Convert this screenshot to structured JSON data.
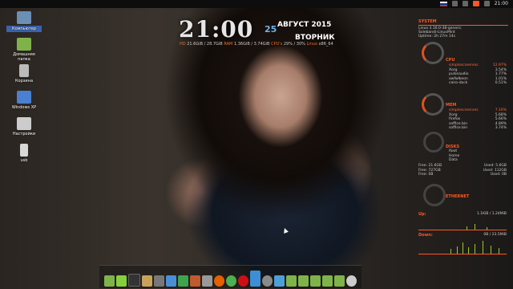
{
  "topbar": {
    "time": "21:00",
    "icons": [
      "flag-icon",
      "network-icon",
      "battery-icon",
      "app-icon",
      "power-icon"
    ]
  },
  "desktop_icons": [
    {
      "label": "Компьютер",
      "icon": "computer-icon",
      "color": "#6b8fb5",
      "selected": true
    },
    {
      "label": "Домашняя папка",
      "icon": "home-folder-icon",
      "color": "#7fb34a"
    },
    {
      "label": "Корзина",
      "icon": "trash-icon",
      "color": "#bbbbbb"
    },
    {
      "label": "Windows XP",
      "icon": "windows-xp-icon",
      "color": "#4a7fd1"
    },
    {
      "label": "Настройки",
      "icon": "settings-icon",
      "color": "#cccccc"
    },
    {
      "label": "usb",
      "icon": "usb-drive-icon",
      "color": "#d8d8d8"
    }
  ],
  "clock": {
    "time": "21:00",
    "day": "25",
    "month": "АВГУСТ 2015",
    "weekday": "ВТОРНИК"
  },
  "sysinfo": {
    "hd_label": "HD",
    "hd_value": "21.6GiB / 28.7GiB",
    "ram_label": "RAM",
    "ram_value": "1.36GiB / 3.74GiB",
    "cpu_label": "CPU's",
    "cpu_value": "29% / 30%",
    "os_label": "Linux",
    "os_value": "x86_64"
  },
  "conky": {
    "system_title": "SYSTEM",
    "kernel": "Linux 3.16.0-38-generic",
    "host": "Solebandi-LinuxMint",
    "uptime": "Uptime: 2h 27m 14s",
    "cpu_title": "CPU",
    "cpu_procs": [
      {
        "name": "simplescreenrec",
        "val": "12.97%",
        "hl": true
      },
      {
        "name": "Xorg",
        "val": "3.54%"
      },
      {
        "name": "pulseaudio",
        "val": "1.77%"
      },
      {
        "name": "awfwlkeon",
        "val": "1.01%"
      },
      {
        "name": "cairo-dock",
        "val": "0.51%"
      }
    ],
    "mem_title": "MEM",
    "mem_procs": [
      {
        "name": "simplescreenrec",
        "val": "7.16%",
        "hl": true
      },
      {
        "name": "Xorg",
        "val": "5.68%"
      },
      {
        "name": "firefox",
        "val": "5.66%"
      },
      {
        "name": "soffice.bin",
        "val": "4.89%"
      },
      {
        "name": "soffice.bin",
        "val": "3.74%"
      }
    ],
    "disks_title": "DISKS",
    "disks_items": [
      "Root",
      "Home",
      "Data"
    ],
    "free_rows": [
      {
        "free": "Free: 21.6GB",
        "used": "Used: 5.6GB"
      },
      {
        "free": "Free: 727GB",
        "used": "Used: 112GB"
      },
      {
        "free": "Free: 0B",
        "used": "Used: 0B"
      }
    ],
    "eth_title": "ETHERNET",
    "up_label": "Up:",
    "up_value": "1.1KiB / 1.24MiB",
    "down_label": "Down:",
    "down_value": "0B / 23.5MiB"
  },
  "dock_items": [
    {
      "icon": "file-manager-icon",
      "color": "#7fb34a"
    },
    {
      "icon": "linux-mint-icon",
      "color": "#87cf3e"
    },
    {
      "icon": "terminal-icon",
      "color": "#333333"
    },
    {
      "icon": "text-editor-icon",
      "color": "#c9a25a"
    },
    {
      "icon": "calculator-icon",
      "color": "#777777"
    },
    {
      "icon": "document-icon",
      "color": "#4b8ed8"
    },
    {
      "icon": "spreadsheet-icon",
      "color": "#3fa34d"
    },
    {
      "icon": "presentation-icon",
      "color": "#c05a2f"
    },
    {
      "icon": "settings-icon",
      "color": "#999999"
    },
    {
      "icon": "firefox-icon",
      "color": "#e66000"
    },
    {
      "icon": "chrome-icon",
      "color": "#4caf50"
    },
    {
      "icon": "opera-icon",
      "color": "#cc0f16"
    },
    {
      "icon": "image-viewer-icon",
      "color": "#3c8fd5"
    },
    {
      "icon": "screen-recorder-icon",
      "color": "#8a8a8a"
    },
    {
      "icon": "network-icon",
      "color": "#4e9fd8"
    },
    {
      "icon": "folder-icon",
      "color": "#7fb34a"
    },
    {
      "icon": "folder-icon",
      "color": "#7fb34a"
    },
    {
      "icon": "folder-icon",
      "color": "#7fb34a"
    },
    {
      "icon": "folder-icon",
      "color": "#7fb34a"
    },
    {
      "icon": "folder-icon",
      "color": "#7fb34a"
    },
    {
      "icon": "system-settings-icon",
      "color": "#cccccc"
    }
  ],
  "accent_color": "#ff5722"
}
